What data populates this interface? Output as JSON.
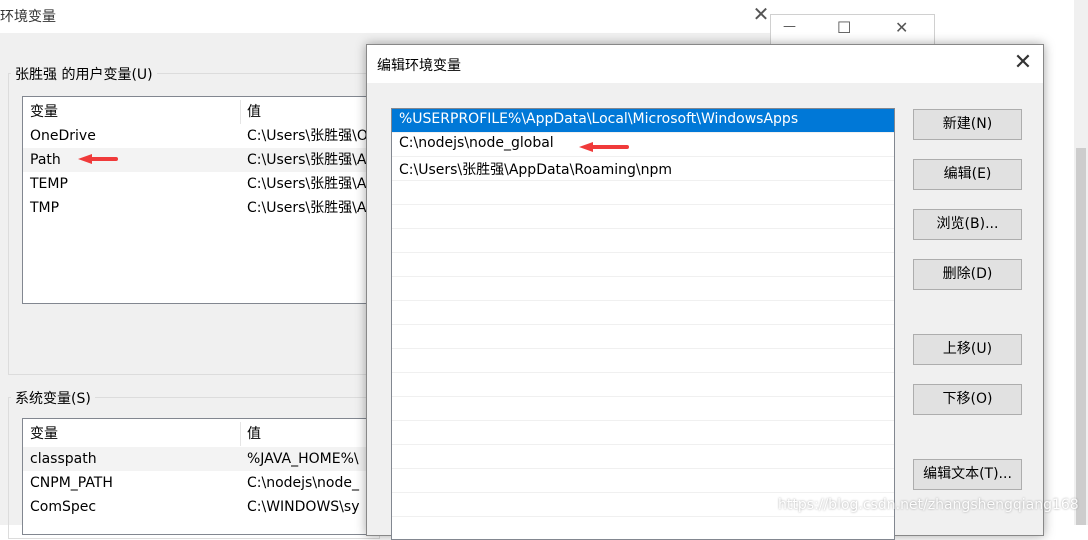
{
  "bg_window": {
    "title": "环境变量",
    "user_group_label": "张胜强 的用户变量(U)",
    "system_group_label": "系统变量(S)",
    "columns": [
      "变量",
      "值"
    ],
    "user_vars": [
      {
        "name": "OneDrive",
        "value": "C:\\Users\\张胜强\\O"
      },
      {
        "name": "Path",
        "value": "C:\\Users\\张胜强\\A"
      },
      {
        "name": "TEMP",
        "value": "C:\\Users\\张胜强\\A"
      },
      {
        "name": "TMP",
        "value": "C:\\Users\\张胜强\\A"
      }
    ],
    "system_vars": [
      {
        "name": "classpath",
        "value": "%JAVA_HOME%\\"
      },
      {
        "name": "CNPM_PATH",
        "value": "C:\\nodejs\\node_"
      },
      {
        "name": "ComSpec",
        "value": "C:\\WINDOWS\\sy"
      }
    ]
  },
  "dialog": {
    "title": "编辑环境变量",
    "paths": [
      "%USERPROFILE%\\AppData\\Local\\Microsoft\\WindowsApps",
      "C:\\nodejs\\node_global",
      "C:\\Users\\张胜强\\AppData\\Roaming\\npm"
    ],
    "selected_index": 0,
    "buttons": {
      "new": "新建(N)",
      "edit": "编辑(E)",
      "browse": "浏览(B)...",
      "delete": "删除(D)",
      "move_up": "上移(U)",
      "move_down": "下移(O)",
      "edit_text": "编辑文本(T)..."
    }
  },
  "window_controls": {
    "close": "✕",
    "maximize": "☐",
    "minimize": "—"
  },
  "watermark": "https://blog.csdn.net/zhangshengqiang168",
  "colors": {
    "selection": "#0078d7",
    "annotation_arrow": "#f03a3a"
  }
}
